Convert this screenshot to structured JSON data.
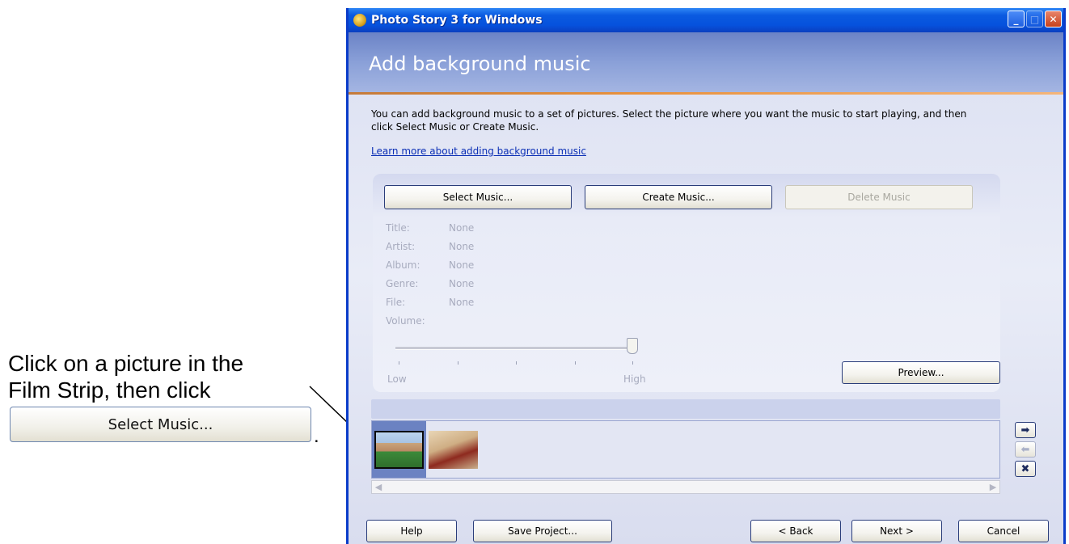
{
  "annotation": {
    "text_line1": "Click on a picture in the",
    "text_line2": "Film Strip, then click",
    "button_label": "Select Music...",
    "period": "."
  },
  "window": {
    "title": "Photo Story 3 for Windows",
    "header_title": "Add background music",
    "description": "You can add background music to a set of pictures.  Select the picture where you want the music to start playing, and then click Select Music or Create Music.",
    "learn_link": "Learn more about adding background music",
    "buttons": {
      "select_music": "Select Music...",
      "create_music": "Create Music...",
      "delete_music": "Delete Music",
      "preview": "Preview..."
    },
    "metadata": [
      {
        "label": "Title:",
        "value": "None"
      },
      {
        "label": "Artist:",
        "value": "None"
      },
      {
        "label": "Album:",
        "value": "None"
      },
      {
        "label": "Genre:",
        "value": "None"
      },
      {
        "label": "File:",
        "value": "None"
      }
    ],
    "volume_label": "Volume:",
    "volume_low": "Low",
    "volume_high": "High",
    "volume_level": 1.0,
    "filmstrip": {
      "selected_index": 0,
      "side_buttons": {
        "move_right": "➡",
        "move_left": "⬅",
        "remove": "✖"
      }
    },
    "footer": {
      "help": "Help",
      "save_project": "Save Project...",
      "back": "< Back",
      "next": "Next >",
      "cancel": "Cancel"
    },
    "titlebar_buttons": {
      "minimize": "_",
      "maximize": "□",
      "close": "✕"
    }
  }
}
